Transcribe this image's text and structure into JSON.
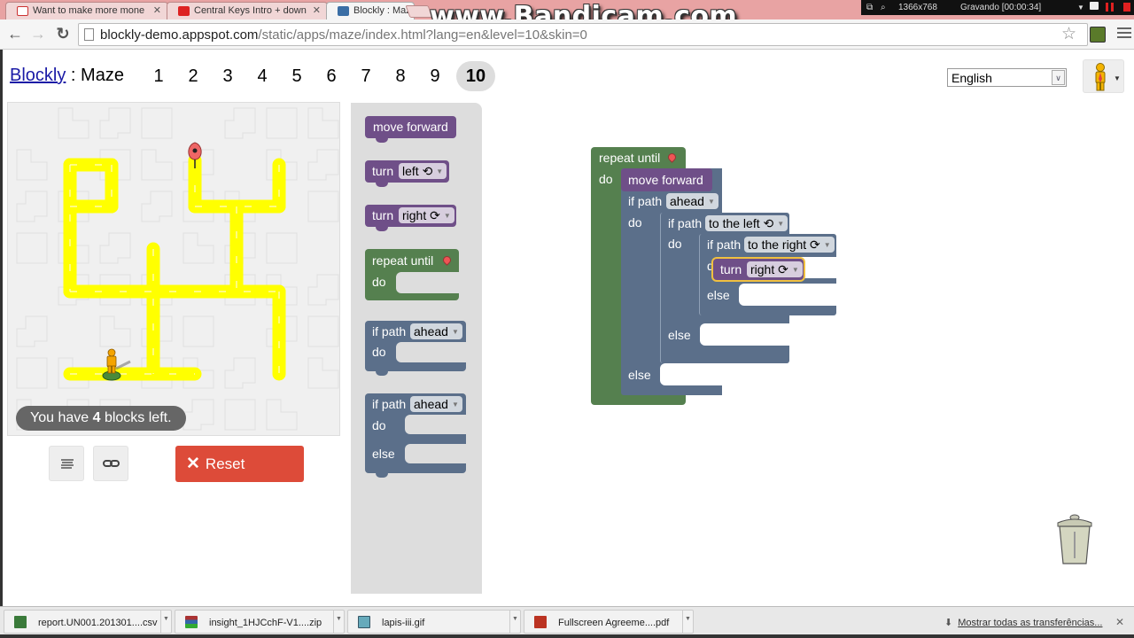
{
  "browser": {
    "tabs": [
      {
        "title": "Want to make more mone",
        "icon": "gmail-icon"
      },
      {
        "title": "Central Keys Intro + down",
        "icon": "youtube-icon"
      },
      {
        "title": "Blockly : Maze",
        "icon": "blockly-icon",
        "active": true
      }
    ],
    "url_host": "blockly-demo.appspot.com",
    "url_path": "/static/apps/maze/index.html?lang=en&level=10&skin=0",
    "watermark": "www.Bandicam.com",
    "recorder": {
      "resolution": "1366x768",
      "status": "Gravando [00:00:34]"
    }
  },
  "header": {
    "brand_link": "Blockly",
    "separator": " : ",
    "app_name": "Maze",
    "levels": [
      "1",
      "2",
      "3",
      "4",
      "5",
      "6",
      "7",
      "8",
      "9",
      "10"
    ],
    "current_level": "10",
    "language": "English"
  },
  "maze": {
    "blocks_left_prefix": "You have ",
    "blocks_left_count": "4",
    "blocks_left_suffix": " blocks left.",
    "path_color": "#ffff00",
    "marker_color": "#ee6666"
  },
  "controls": {
    "code_button_icon": "text-lines-icon",
    "link_button_icon": "link-icon",
    "reset_label": "Reset",
    "reset_color": "#dd4b39"
  },
  "toolbox": {
    "move_forward": "move forward",
    "turn_left": {
      "label": "turn",
      "value": "left ⟲"
    },
    "turn_right": {
      "label": "turn",
      "value": "right ⟳"
    },
    "repeat_until": {
      "label": "repeat until",
      "do": "do"
    },
    "if_path": {
      "label": "if path",
      "value": "ahead",
      "do": "do"
    },
    "if_else_path": {
      "label": "if path",
      "value": "ahead",
      "do": "do",
      "else": "else"
    }
  },
  "program": {
    "repeat_label": "repeat until",
    "do": "do",
    "else": "else",
    "move_forward": "move forward",
    "if1": {
      "label": "if path",
      "value": "ahead"
    },
    "if2": {
      "label": "if path",
      "value": "to the left ⟲"
    },
    "if3": {
      "label": "if path",
      "value": "to the right ⟳"
    },
    "selected_turn": {
      "label": "turn",
      "value": "right ⟳"
    }
  },
  "colors": {
    "movement_block": "#6f4f88",
    "loop_block": "#55804f",
    "logic_block": "#5b6f8a",
    "selection_outline": "#f0c040"
  },
  "downloads": {
    "items": [
      {
        "name": "report.UN001.201301....csv",
        "icon": "excel-file-icon"
      },
      {
        "name": "insight_1HJCchF-V1....zip",
        "icon": "archive-file-icon"
      },
      {
        "name": "lapis-iii.gif",
        "icon": "image-file-icon"
      },
      {
        "name": "Fullscreen Agreeme....pdf",
        "icon": "pdf-file-icon"
      }
    ],
    "show_all": "Mostrar todas as transferências..."
  }
}
